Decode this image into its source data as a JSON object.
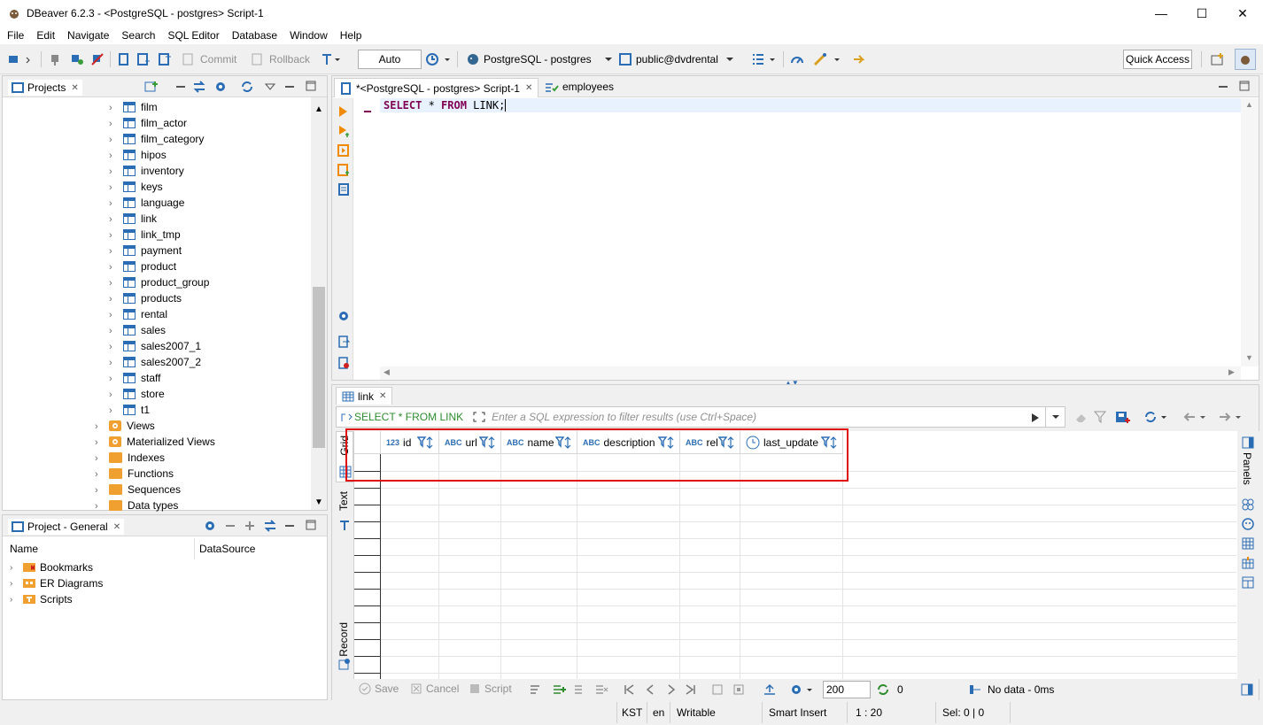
{
  "window": {
    "title": "DBeaver 6.2.3 - <PostgreSQL - postgres> Script-1",
    "minimize": "—",
    "maximize": "☐",
    "close": "✕"
  },
  "menu": [
    "File",
    "Edit",
    "Navigate",
    "Search",
    "SQL Editor",
    "Database",
    "Window",
    "Help"
  ],
  "toolbar": {
    "commit": "Commit",
    "rollback": "Rollback",
    "mode": "Auto",
    "connection": "PostgreSQL - postgres",
    "schema": "public@dvdrental",
    "quick_access": "Quick Access"
  },
  "projects": {
    "tab": "Projects",
    "tables": [
      "film",
      "film_actor",
      "film_category",
      "hipos",
      "inventory",
      "keys",
      "language",
      "link",
      "link_tmp",
      "payment",
      "product",
      "product_group",
      "products",
      "rental",
      "sales",
      "sales2007_1",
      "sales2007_2",
      "staff",
      "store",
      "t1"
    ],
    "folders": [
      {
        "label": "Views",
        "kind": "view"
      },
      {
        "label": "Materialized Views",
        "kind": "view"
      },
      {
        "label": "Indexes",
        "kind": "folder"
      },
      {
        "label": "Functions",
        "kind": "folder"
      },
      {
        "label": "Sequences",
        "kind": "folder"
      },
      {
        "label": "Data types",
        "kind": "folder"
      }
    ]
  },
  "project_general": {
    "tab": "Project - General",
    "col_name": "Name",
    "col_datasource": "DataSource",
    "items": [
      "Bookmarks",
      "ER Diagrams",
      "Scripts"
    ]
  },
  "editor": {
    "tab_active": "*<PostgreSQL - postgres> Script-1",
    "tab_other": "employees",
    "sql_keyword1": "SELECT",
    "sql_star": " * ",
    "sql_keyword2": "FROM",
    "sql_rest": " LINK;"
  },
  "results": {
    "tab": "link",
    "query": "SELECT * FROM LINK",
    "filter_placeholder": "Enter a SQL expression to filter results (use Ctrl+Space)",
    "side_tabs": [
      "Grid",
      "Text",
      "Record"
    ],
    "right_panel": "Panels",
    "columns": [
      {
        "type": "123",
        "name": "id"
      },
      {
        "type": "ABC",
        "name": "url"
      },
      {
        "type": "ABC",
        "name": "name"
      },
      {
        "type": "ABC",
        "name": "description"
      },
      {
        "type": "ABC",
        "name": "rel"
      },
      {
        "type": "clock",
        "name": "last_update"
      }
    ],
    "bottom": {
      "save": "Save",
      "cancel": "Cancel",
      "script": "Script",
      "fetch_size": "200",
      "refresh_count": "0",
      "status": "No data - 0ms"
    }
  },
  "statusbar": {
    "tz": "KST",
    "lang": "en",
    "mode": "Writable",
    "insert": "Smart Insert",
    "pos": "1 : 20",
    "sel": "Sel: 0 | 0"
  },
  "colors": {
    "accent": "#2b6db5",
    "highlight_box": "#e01010",
    "keyword": "#7f0055",
    "folder": "#f0a030"
  }
}
